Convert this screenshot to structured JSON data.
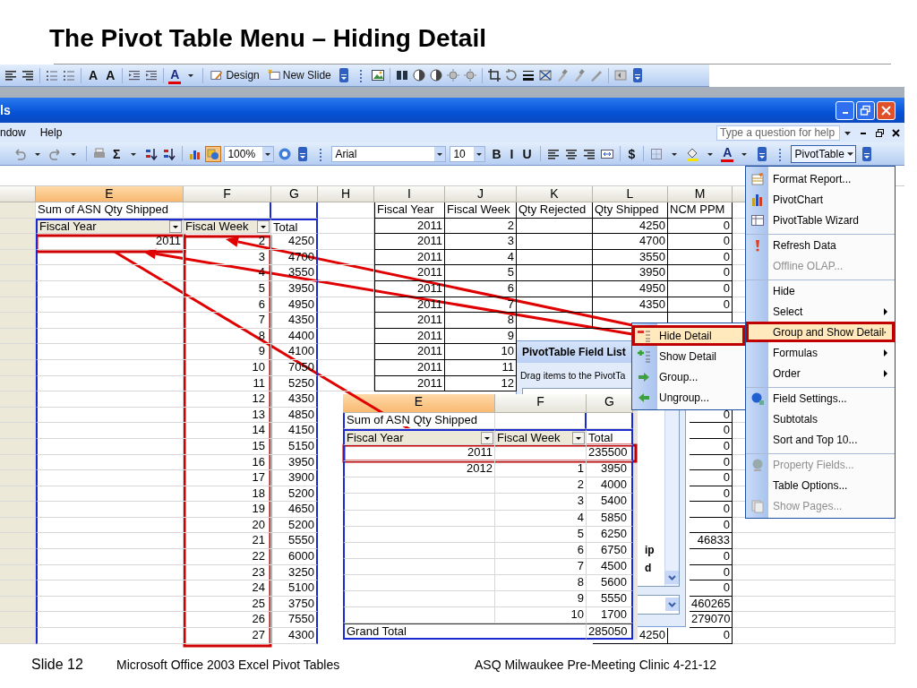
{
  "slide_title": "The Pivot Table Menu – Hiding Detail",
  "presentation_toolbar": [
    {
      "kind": "alignleft"
    },
    {
      "kind": "alignright"
    },
    {
      "kind": "separator"
    },
    {
      "kind": "bullets"
    },
    {
      "kind": "numbering"
    },
    {
      "kind": "separator"
    },
    {
      "kind": "text",
      "label": "A"
    },
    {
      "kind": "text",
      "label": "A"
    },
    {
      "kind": "separator"
    },
    {
      "kind": "outdent"
    },
    {
      "kind": "indent"
    },
    {
      "kind": "separator"
    },
    {
      "kind": "fontcolor",
      "label": "A"
    },
    {
      "kind": "caret"
    },
    {
      "kind": "separator"
    },
    {
      "kind": "design",
      "label": "Design"
    },
    {
      "kind": "newslide",
      "label": "New Slide"
    },
    {
      "kind": "overflow"
    },
    {
      "kind": "grip"
    },
    {
      "kind": "image"
    },
    {
      "kind": "separator"
    },
    {
      "kind": "columns"
    },
    {
      "kind": "contrast"
    },
    {
      "kind": "contrast"
    },
    {
      "kind": "sun"
    },
    {
      "kind": "sun"
    },
    {
      "kind": "separator"
    },
    {
      "kind": "crop"
    },
    {
      "kind": "rotate"
    },
    {
      "kind": "lines"
    },
    {
      "kind": "compress"
    },
    {
      "kind": "brush"
    },
    {
      "kind": "brush"
    },
    {
      "kind": "pen"
    },
    {
      "kind": "separator"
    },
    {
      "kind": "reset"
    },
    {
      "kind": "overflow"
    }
  ],
  "window": {
    "title": "ls"
  },
  "menu_bar": [
    "ndow",
    "Help"
  ],
  "help_search": {
    "placeholder": "Type a question for help"
  },
  "formatting_toolbar": [
    {
      "kind": "undo",
      "on": false
    },
    {
      "kind": "caret",
      "on": false
    },
    {
      "kind": "redo",
      "on": false
    },
    {
      "kind": "caret",
      "on": false
    },
    {
      "kind": "separator"
    },
    {
      "kind": "print",
      "on": false
    },
    {
      "kind": "text",
      "label": "Σ",
      "on": false
    },
    {
      "kind": "caret",
      "on": false
    },
    {
      "kind": "sortup",
      "on": false
    },
    {
      "kind": "sortdown",
      "on": false
    },
    {
      "kind": "separator"
    },
    {
      "kind": "chart",
      "on": false
    },
    {
      "kind": "drawing",
      "on": true
    },
    {
      "kind": "combo",
      "value": "100%",
      "on": false
    },
    {
      "kind": "help",
      "on": false
    },
    {
      "kind": "overflow"
    },
    {
      "kind": "grip"
    },
    {
      "kind": "combo",
      "value": "Arial",
      "on": false
    },
    {
      "kind": "combo",
      "value": "10",
      "on": false
    },
    {
      "kind": "text",
      "label": "B",
      "on": false
    },
    {
      "kind": "text",
      "label": "I",
      "on": false
    },
    {
      "kind": "text",
      "label": "U",
      "on": false
    },
    {
      "kind": "separator"
    },
    {
      "kind": "alignleft",
      "on": false
    },
    {
      "kind": "aligncenter",
      "on": false
    },
    {
      "kind": "alignright",
      "on": false
    },
    {
      "kind": "merge",
      "on": false
    },
    {
      "kind": "separator"
    },
    {
      "kind": "text",
      "label": "$",
      "on": false
    },
    {
      "kind": "separator"
    },
    {
      "kind": "borders",
      "on": false
    },
    {
      "kind": "caret",
      "on": false
    },
    {
      "kind": "fill",
      "on": false
    },
    {
      "kind": "caret",
      "on": false
    },
    {
      "kind": "fontcolor",
      "label": "A",
      "on": false
    },
    {
      "kind": "caret",
      "on": false
    },
    {
      "kind": "overflow"
    },
    {
      "kind": "grip"
    },
    {
      "kind": "dropdown",
      "label": "PivotTable",
      "on": false
    },
    {
      "kind": "overflow"
    }
  ],
  "sheet": {
    "columns": [
      {
        "label": "E",
        "selected": true
      },
      {
        "label": "F",
        "selected": false
      },
      {
        "label": "G",
        "selected": false
      },
      {
        "label": "H",
        "selected": false
      },
      {
        "label": "I",
        "selected": false
      },
      {
        "label": "J",
        "selected": false
      },
      {
        "label": "K",
        "selected": false
      },
      {
        "label": "L",
        "selected": false
      },
      {
        "label": "M",
        "selected": false
      }
    ],
    "pivot": {
      "title": "Sum of ASN Qty Shipped",
      "row_field": "Fiscal Year",
      "column_field": "Fiscal Week",
      "total_label": "Total",
      "rows": [
        {
          "year": "2011",
          "week": "2",
          "total": "4250"
        },
        {
          "week": "3",
          "total": "4700"
        },
        {
          "week": "4",
          "total": "3550"
        },
        {
          "week": "5",
          "total": "3950"
        },
        {
          "week": "6",
          "total": "4950"
        },
        {
          "week": "7",
          "total": "4350"
        },
        {
          "week": "8",
          "total": "4400"
        },
        {
          "week": "9",
          "total": "4100"
        },
        {
          "week": "10",
          "total": "7050"
        },
        {
          "week": "11",
          "total": "5250"
        },
        {
          "week": "12",
          "total": "4350"
        },
        {
          "week": "13",
          "total": "4850"
        },
        {
          "week": "14",
          "total": "4150"
        },
        {
          "week": "15",
          "total": "5150"
        },
        {
          "week": "16",
          "total": "3950"
        },
        {
          "week": "17",
          "total": "3900"
        },
        {
          "week": "18",
          "total": "5200"
        },
        {
          "week": "19",
          "total": "4650"
        },
        {
          "week": "20",
          "total": "5200"
        },
        {
          "week": "21",
          "total": "5550"
        },
        {
          "week": "22",
          "total": "6000"
        },
        {
          "week": "23",
          "total": "3250"
        },
        {
          "week": "24",
          "total": "5100"
        },
        {
          "week": "25",
          "total": "3750"
        },
        {
          "week": "26",
          "total": "7550"
        },
        {
          "week": "27",
          "total": "4300"
        }
      ]
    },
    "data_table": {
      "headers": [
        "Fiscal Year",
        "Fiscal Week",
        "Qty Rejected",
        "Qty Shipped",
        "NCM PPM"
      ],
      "rows": [
        {
          "fiscal_year": "2011",
          "fiscal_week": "2",
          "qty_shipped": "4250",
          "ncm_ppm": "0"
        },
        {
          "fiscal_year": "2011",
          "fiscal_week": "3",
          "qty_shipped": "4700",
          "ncm_ppm": "0"
        },
        {
          "fiscal_year": "2011",
          "fiscal_week": "4",
          "qty_shipped": "3550",
          "ncm_ppm": "0"
        },
        {
          "fiscal_year": "2011",
          "fiscal_week": "5",
          "qty_shipped": "3950",
          "ncm_ppm": "0"
        },
        {
          "fiscal_year": "2011",
          "fiscal_week": "6",
          "qty_shipped": "4950",
          "ncm_ppm": "0"
        },
        {
          "fiscal_year": "2011",
          "fiscal_week": "7",
          "qty_shipped": "4350",
          "ncm_ppm": "0"
        },
        {
          "fiscal_year": "2011",
          "fiscal_week": "8"
        },
        {
          "fiscal_year": "2011",
          "fiscal_week": "9"
        },
        {
          "fiscal_year": "2011",
          "fiscal_week": "10"
        },
        {
          "fiscal_year": "2011",
          "fiscal_week": "11"
        },
        {
          "fiscal_year": "2011",
          "fiscal_week": "12"
        }
      ],
      "lower_rows": [
        {
          "ncm_ppm": "0"
        },
        {
          "ncm_ppm": "0"
        },
        {
          "ncm_ppm": "0"
        },
        {
          "ncm_ppm": "0"
        },
        {
          "ncm_ppm": "0"
        },
        {
          "ncm_ppm": "0"
        },
        {
          "ncm_ppm": "0"
        },
        {
          "ncm_ppm": "0"
        },
        {
          "ncm_ppm": "46833"
        },
        {
          "ncm_ppm": "0"
        },
        {
          "ncm_ppm": "0"
        },
        {
          "ncm_ppm": "0"
        },
        {
          "ncm_ppm": "460265"
        },
        {
          "ncm_ppm": "279070"
        },
        {
          "qty_shipped": "4250",
          "ncm_ppm": "0"
        }
      ]
    }
  },
  "pivot_preview": {
    "columns": [
      {
        "label": "E",
        "selected": true
      },
      {
        "label": "F",
        "selected": false
      },
      {
        "label": "G",
        "selected": false
      }
    ],
    "title": "Sum of ASN Qty Shipped",
    "row_field": "Fiscal Year",
    "column_field": "Fiscal Week",
    "total_label": "Total",
    "rows": [
      {
        "year": "2011",
        "total": "235500"
      },
      {
        "year": "2012",
        "week": "1",
        "total": "3950"
      },
      {
        "week": "2",
        "total": "4000"
      },
      {
        "week": "3",
        "total": "5400"
      },
      {
        "week": "4",
        "total": "5850"
      },
      {
        "week": "5",
        "total": "6250"
      },
      {
        "week": "6",
        "total": "6750"
      },
      {
        "week": "7",
        "total": "4500"
      },
      {
        "week": "8",
        "total": "5600"
      },
      {
        "week": "9",
        "total": "5550"
      },
      {
        "week": "10",
        "total": "1700"
      }
    ],
    "grand_total_label": "Grand Total",
    "grand_total": "285050"
  },
  "field_list": {
    "title": "PivotTable Field List",
    "instruction": "Drag items to the PivotTa",
    "items": [
      "ip",
      "d"
    ]
  },
  "pivottable_menu": {
    "items": [
      {
        "label": "Format Report...",
        "disabled": false,
        "selected": false,
        "submenu": false,
        "separator_above": false
      },
      {
        "label": "PivotChart",
        "disabled": false,
        "selected": false,
        "submenu": false,
        "separator_above": false
      },
      {
        "label": "PivotTable Wizard",
        "disabled": false,
        "selected": false,
        "submenu": false,
        "separator_above": false
      },
      {
        "label": "Refresh Data",
        "disabled": false,
        "selected": false,
        "submenu": false,
        "separator_above": true
      },
      {
        "label": "Offline OLAP...",
        "disabled": true,
        "selected": false,
        "submenu": false,
        "separator_above": false
      },
      {
        "label": "Hide",
        "disabled": false,
        "selected": false,
        "submenu": false,
        "separator_above": true
      },
      {
        "label": "Select",
        "disabled": false,
        "selected": false,
        "submenu": true,
        "separator_above": false
      },
      {
        "label": "Group and Show Detail",
        "disabled": false,
        "selected": true,
        "submenu": true,
        "separator_above": false
      },
      {
        "label": "Formulas",
        "disabled": false,
        "selected": false,
        "submenu": true,
        "separator_above": false
      },
      {
        "label": "Order",
        "disabled": false,
        "selected": false,
        "submenu": true,
        "separator_above": false
      },
      {
        "label": "Field Settings...",
        "disabled": false,
        "selected": false,
        "submenu": false,
        "separator_above": true
      },
      {
        "label": "Subtotals",
        "disabled": false,
        "selected": false,
        "submenu": false,
        "separator_above": false
      },
      {
        "label": "Sort and Top 10...",
        "disabled": false,
        "selected": false,
        "submenu": false,
        "separator_above": false
      },
      {
        "label": "Property Fields...",
        "disabled": true,
        "selected": false,
        "submenu": false,
        "separator_above": true
      },
      {
        "label": "Table Options...",
        "disabled": false,
        "selected": false,
        "submenu": false,
        "separator_above": false
      },
      {
        "label": "Show Pages...",
        "disabled": true,
        "selected": false,
        "submenu": false,
        "separator_above": false
      }
    ]
  },
  "detail_submenu": {
    "items": [
      {
        "label": "Hide Detail",
        "selected": true
      },
      {
        "label": "Show Detail",
        "selected": false
      },
      {
        "label": "Group...",
        "selected": false
      },
      {
        "label": "Ungroup...",
        "selected": false
      }
    ]
  },
  "footer": {
    "slide_number": "Slide 12",
    "course": "Microsoft Office 2003 Excel Pivot Tables",
    "event": "ASQ Milwaukee Pre-Meeting Clinic 4-21-12"
  }
}
